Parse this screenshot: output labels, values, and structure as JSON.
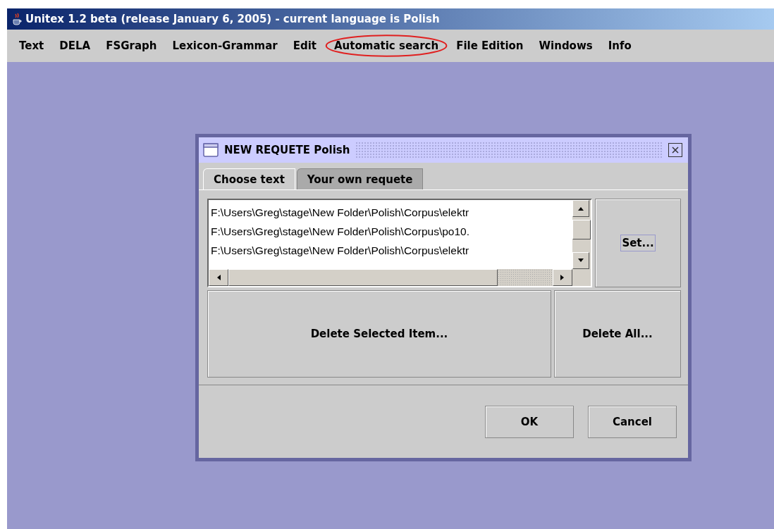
{
  "window": {
    "title": "Unitex 1.2 beta (release January 6, 2005) - current language is Polish"
  },
  "menu": [
    {
      "label": "Text",
      "highlighted": false
    },
    {
      "label": "DELA",
      "highlighted": false
    },
    {
      "label": "FSGraph",
      "highlighted": false
    },
    {
      "label": "Lexicon-Grammar",
      "highlighted": false
    },
    {
      "label": "Edit",
      "highlighted": false
    },
    {
      "label": "Automatic search",
      "highlighted": true
    },
    {
      "label": "File Edition",
      "highlighted": false
    },
    {
      "label": "Windows",
      "highlighted": false
    },
    {
      "label": "Info",
      "highlighted": false
    }
  ],
  "dialog": {
    "title": "NEW REQUETE Polish",
    "tabs": [
      {
        "label": "Choose text",
        "selected": true
      },
      {
        "label": "Your own requete",
        "selected": false
      }
    ],
    "files": [
      "F:\\Users\\Greg\\stage\\New Folder\\Polish\\Corpus\\elektr",
      "F:\\Users\\Greg\\stage\\New Folder\\Polish\\Corpus\\po10.",
      "F:\\Users\\Greg\\stage\\New Folder\\Polish\\Corpus\\elektr"
    ],
    "set_button": "Set...",
    "delete_selected_button": "Delete Selected Item...",
    "delete_all_button": "Delete All...",
    "buttons": [
      "OK",
      "Cancel"
    ]
  }
}
